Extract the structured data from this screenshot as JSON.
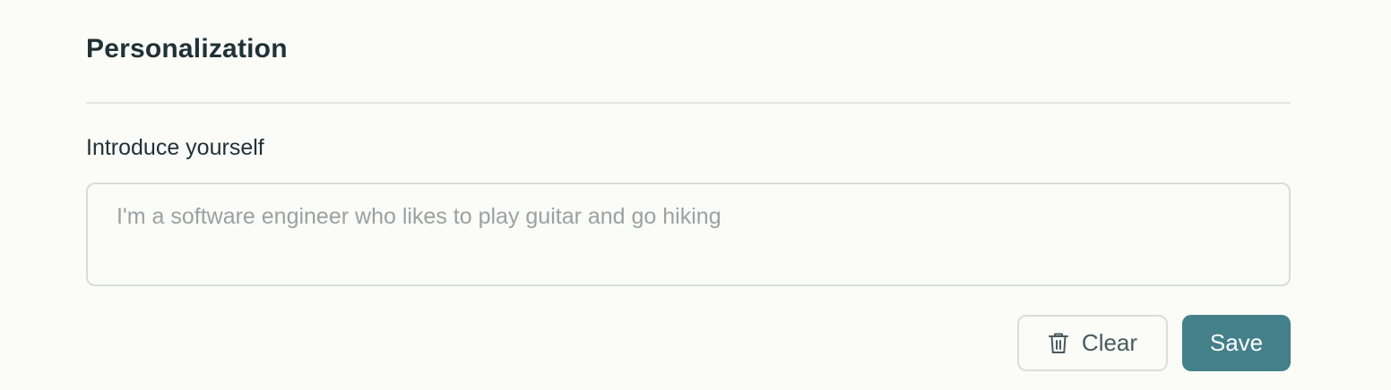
{
  "section": {
    "title": "Personalization"
  },
  "intro_field": {
    "label": "Introduce yourself",
    "value": "",
    "placeholder": "I'm a software engineer who likes to play guitar and go hiking"
  },
  "actions": {
    "clear_label": "Clear",
    "clear_icon": "trash-icon",
    "save_label": "Save"
  },
  "colors": {
    "background": "#fbfbf8",
    "text": "#1f3137",
    "accent": "#43808a",
    "border": "#d9dcd9",
    "placeholder": "#9aa2a3"
  }
}
